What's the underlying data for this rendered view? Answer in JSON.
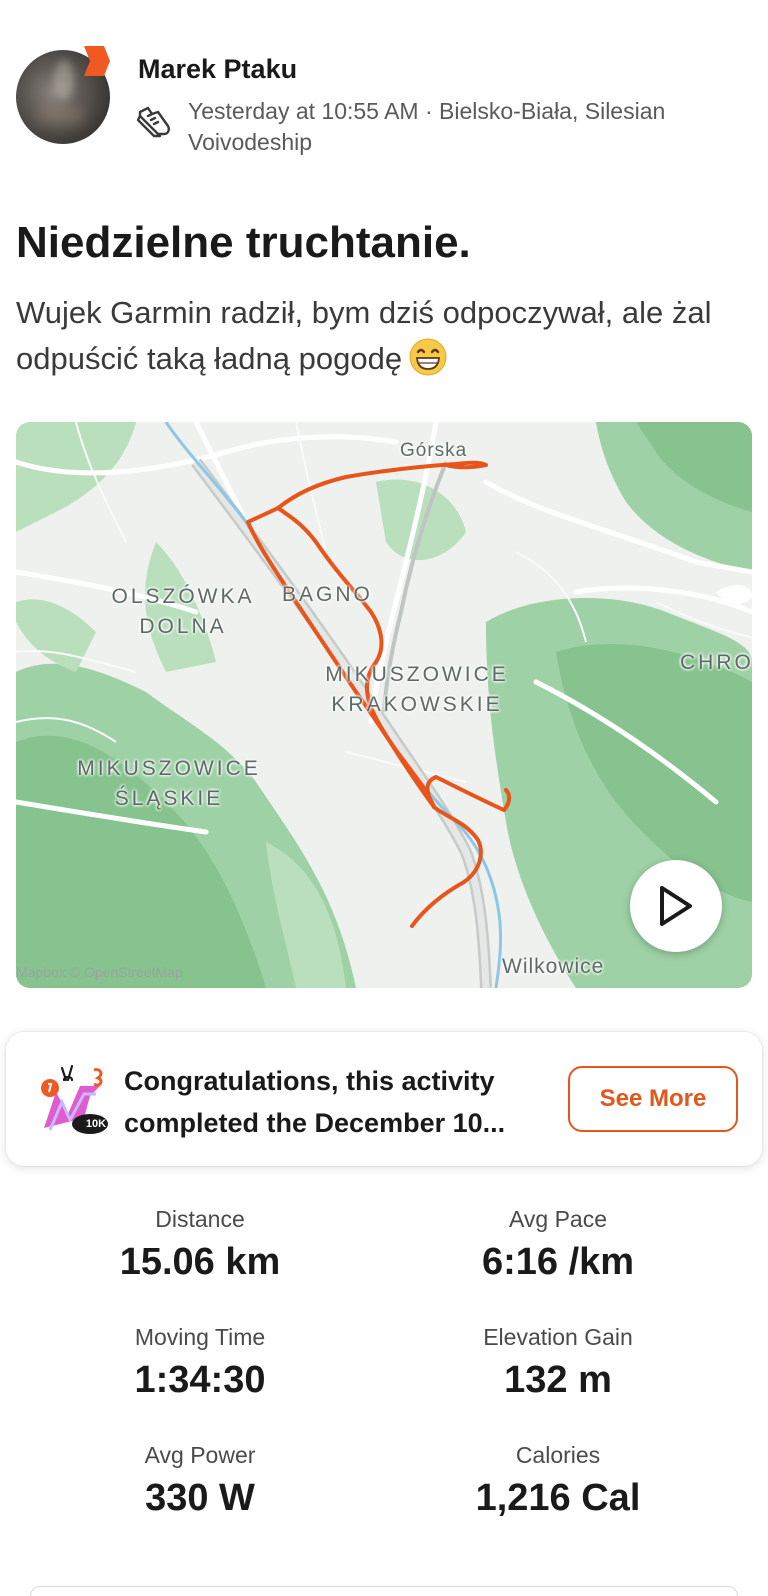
{
  "header": {
    "athlete_name": "Marek Ptaku",
    "meta_text": "Yesterday at 10:55 AM · Bielsko-Biała, Silesian Voivodeship",
    "activity_icon": "running-shoe-icon"
  },
  "activity": {
    "title": "Niedzielne truchtanie.",
    "description": "Wujek Garmin radził, bym dziś odpoczywał, ale żal odpuścić taką ładną pogodę",
    "description_emoji": "grinning-face-emoji"
  },
  "map": {
    "labels": {
      "gorska": "Górska",
      "olszowka": "OLSZÓWKA DOLNA",
      "bagno": "BAGNO",
      "mik_krakowskie": "MIKUSZOWICE KRAKOWSKIE",
      "mik_slaskie": "MIKUSZOWICE ŚLĄSKIE",
      "chro": "CHRO",
      "wilkowice": "Wilkowice"
    },
    "attribution": "Mapbox © OpenStreetMap",
    "route_color": "#e8541a",
    "play_icon": "play-icon"
  },
  "challenge": {
    "text": "Congratulations, this activity completed the December 10...",
    "button_label": "See More",
    "accent_color": "#e2581c",
    "badge_label": "10K"
  },
  "stats": [
    {
      "label": "Distance",
      "value": "15.06 km"
    },
    {
      "label": "Avg Pace",
      "value": "6:16 /km"
    },
    {
      "label": "Moving Time",
      "value": "1:34:30"
    },
    {
      "label": "Elevation Gain",
      "value": "132 m"
    },
    {
      "label": "Avg Power",
      "value": "330 W"
    },
    {
      "label": "Calories",
      "value": "1,216 Cal"
    }
  ]
}
